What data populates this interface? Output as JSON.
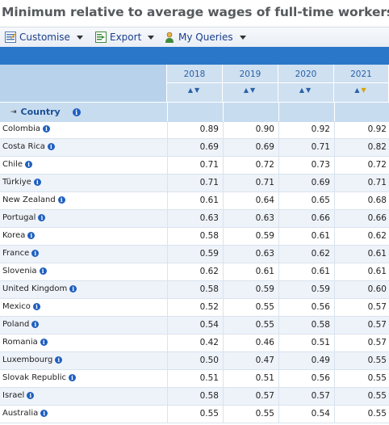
{
  "title": "Minimum relative to average wages of full-time workers",
  "toolbar": {
    "customise": "Customise",
    "export": "Export",
    "my_queries": "My Queries"
  },
  "table": {
    "years": [
      "2018",
      "2019",
      "2020",
      "2021"
    ],
    "country_header": "Country",
    "rows": [
      {
        "country": "Colombia",
        "values": [
          "0.89",
          "0.90",
          "0.92",
          "0.92"
        ]
      },
      {
        "country": "Costa Rica",
        "values": [
          "0.69",
          "0.69",
          "0.71",
          "0.82"
        ]
      },
      {
        "country": "Chile",
        "values": [
          "0.71",
          "0.72",
          "0.73",
          "0.72"
        ]
      },
      {
        "country": "Türkiye",
        "values": [
          "0.71",
          "0.71",
          "0.69",
          "0.71"
        ]
      },
      {
        "country": "New Zealand",
        "values": [
          "0.61",
          "0.64",
          "0.65",
          "0.68"
        ]
      },
      {
        "country": "Portugal",
        "values": [
          "0.63",
          "0.63",
          "0.66",
          "0.66"
        ]
      },
      {
        "country": "Korea",
        "values": [
          "0.58",
          "0.59",
          "0.61",
          "0.62"
        ]
      },
      {
        "country": "France",
        "values": [
          "0.59",
          "0.63",
          "0.62",
          "0.61"
        ]
      },
      {
        "country": "Slovenia",
        "values": [
          "0.62",
          "0.61",
          "0.61",
          "0.61"
        ]
      },
      {
        "country": "United Kingdom",
        "values": [
          "0.58",
          "0.59",
          "0.59",
          "0.60"
        ]
      },
      {
        "country": "Mexico",
        "values": [
          "0.52",
          "0.55",
          "0.56",
          "0.57"
        ]
      },
      {
        "country": "Poland",
        "values": [
          "0.54",
          "0.55",
          "0.58",
          "0.57"
        ]
      },
      {
        "country": "Romania",
        "values": [
          "0.42",
          "0.46",
          "0.51",
          "0.57"
        ]
      },
      {
        "country": "Luxembourg",
        "values": [
          "0.50",
          "0.47",
          "0.49",
          "0.55"
        ]
      },
      {
        "country": "Slovak Republic",
        "values": [
          "0.51",
          "0.51",
          "0.56",
          "0.55"
        ]
      },
      {
        "country": "Israel",
        "values": [
          "0.58",
          "0.57",
          "0.57",
          "0.55"
        ]
      },
      {
        "country": "Australia",
        "values": [
          "0.55",
          "0.55",
          "0.54",
          "0.55"
        ]
      }
    ]
  },
  "colors": {
    "banner": "#2a77c9",
    "header_bg": "#cfe0f1",
    "link_text": "#1b3f8c",
    "sort_highlight": "#d6a300"
  }
}
